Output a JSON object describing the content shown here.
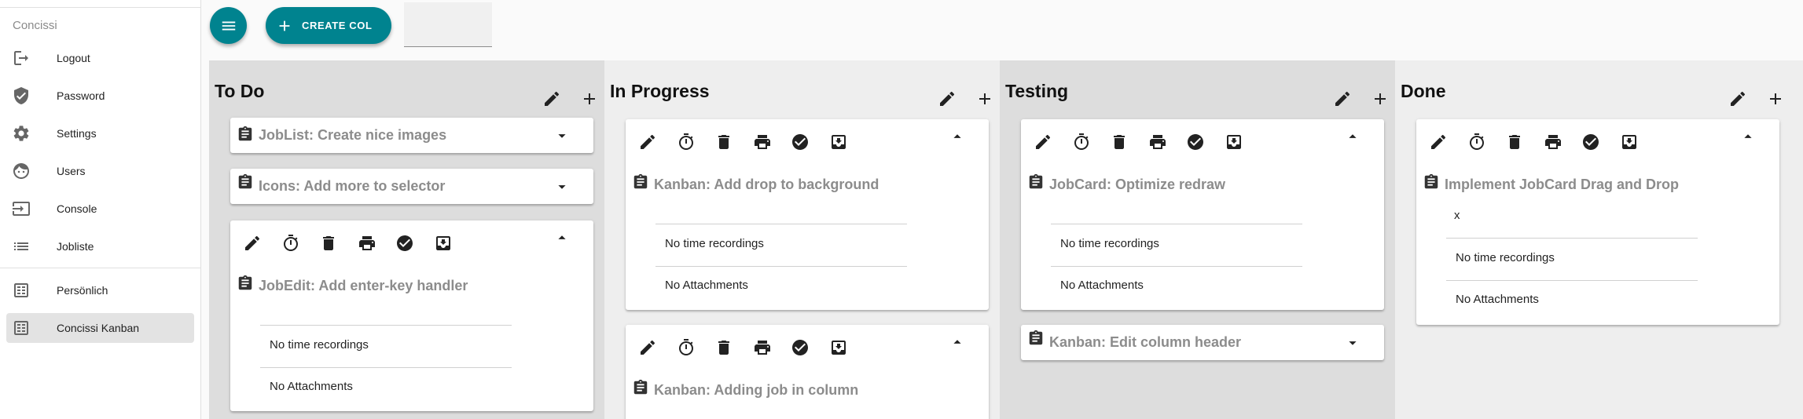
{
  "app": {
    "brand": "Concissi"
  },
  "sidebar": {
    "items": [
      {
        "label": "Logout",
        "icon": "logout-icon"
      },
      {
        "label": "Password",
        "icon": "shield-icon"
      },
      {
        "label": "Settings",
        "icon": "gear-icon"
      },
      {
        "label": "Users",
        "icon": "face-icon"
      },
      {
        "label": "Console",
        "icon": "console-icon"
      },
      {
        "label": "Jobliste",
        "icon": "list-icon"
      },
      {
        "label": "Persönlich",
        "icon": "board-icon"
      },
      {
        "label": "Concissi Kanban",
        "icon": "board-icon",
        "active": true
      }
    ]
  },
  "toolbar": {
    "menu_icon": "menu-icon",
    "create_col_label": "CREATE COL",
    "create_col_icon": "plus-icon",
    "input_value": ""
  },
  "colors": {
    "accent": "#00838f",
    "column_dark": "#dddddd",
    "column_light": "#eeeeee",
    "card_title": "#8c8c8c"
  },
  "board": {
    "card_tools": [
      "edit-icon",
      "timer-icon",
      "delete-icon",
      "print-icon",
      "check-circle-icon",
      "archive-icon"
    ],
    "columns": [
      {
        "title": "To Do",
        "cards": [
          {
            "title": "JobList: Create nice images",
            "expanded": false
          },
          {
            "title": "Icons: Add more to selector",
            "expanded": false
          },
          {
            "title": "JobEdit: Add enter-key handler",
            "expanded": true,
            "time_text": "No time recordings",
            "attach_text": "No Attachments"
          }
        ]
      },
      {
        "title": "In Progress",
        "cards": [
          {
            "title": "Kanban: Add drop to background",
            "expanded": true,
            "time_text": "No time recordings",
            "attach_text": "No Attachments"
          },
          {
            "title": "Kanban: Adding job in column",
            "expanded": true
          }
        ]
      },
      {
        "title": "Testing",
        "cards": [
          {
            "title": "JobCard: Optimize redraw",
            "expanded": true,
            "time_text": "No time recordings",
            "attach_text": "No Attachments"
          },
          {
            "title": "Kanban: Edit column header",
            "expanded": false
          }
        ]
      },
      {
        "title": "Done",
        "cards": [
          {
            "title": "Implement JobCard Drag and Drop",
            "expanded": true,
            "note": "x",
            "time_text": "No time recordings",
            "attach_text": "No Attachments"
          }
        ]
      }
    ]
  }
}
